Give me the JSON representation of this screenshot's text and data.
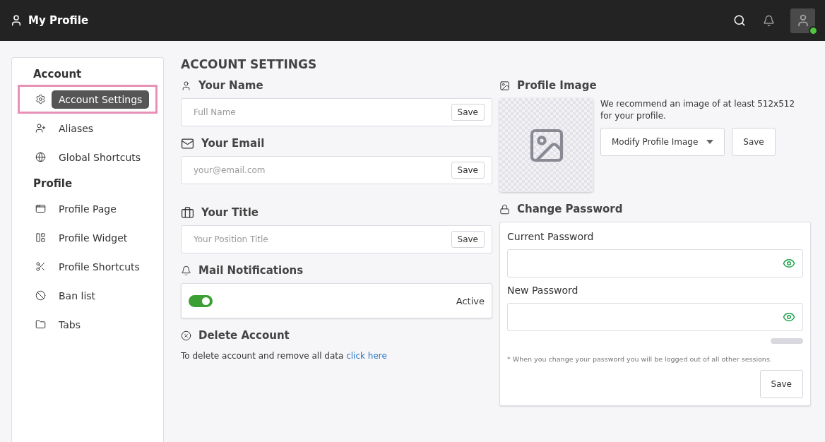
{
  "header": {
    "title": "My Profile",
    "user_online": true
  },
  "sidebar": {
    "groups": [
      {
        "title": "Account",
        "items": [
          {
            "label": "Account Settings",
            "selected": true
          },
          {
            "label": "Aliases",
            "selected": false
          },
          {
            "label": "Global Shortcuts",
            "selected": false
          }
        ]
      },
      {
        "title": "Profile",
        "items": [
          {
            "label": "Profile Page",
            "selected": false
          },
          {
            "label": "Profile Widget",
            "selected": false
          },
          {
            "label": "Profile Shortcuts",
            "selected": false
          },
          {
            "label": "Ban list",
            "selected": false
          },
          {
            "label": "Tabs",
            "selected": false
          }
        ]
      }
    ]
  },
  "page_title": "ACCOUNT SETTINGS",
  "fields": [
    {
      "kind": "name",
      "label": "Your Name",
      "placeholder": "Full Name",
      "button": "Save"
    },
    {
      "kind": "email",
      "label": "Your Email",
      "placeholder": "your@email.com",
      "button": "Save"
    },
    {
      "kind": "title",
      "label": "Your Title",
      "placeholder": "Your Position Title",
      "button": "Save"
    }
  ],
  "mail_notifications": {
    "label": "Mail Notifications",
    "on": true,
    "status": "Active"
  },
  "delete_account": {
    "label": "Delete Account",
    "text": "To delete account and remove all data",
    "link": "click here"
  },
  "profile_image": {
    "label": "Profile Image",
    "hint": "We recommend an image of at least 512x512 for your profile.",
    "dropdown": "Modify Profile Image",
    "button": "Save"
  },
  "change_password": {
    "label": "Change Password",
    "fields": [
      {
        "label": "Current Password"
      },
      {
        "label": "New Password"
      }
    ],
    "note": "* When you change your password you will be logged out of all other sessions.",
    "button": "Save"
  }
}
